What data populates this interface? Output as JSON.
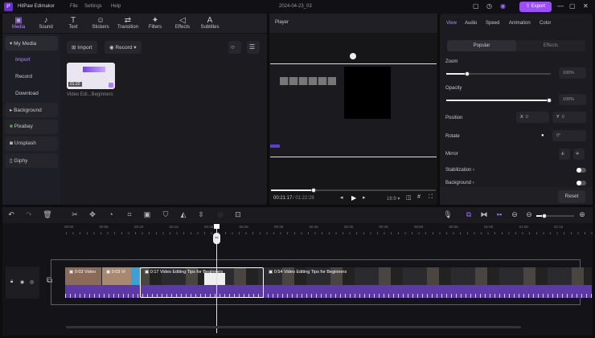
{
  "app": {
    "name": "HitPaw Edimakor",
    "project": "2024-04-23_03",
    "menu": [
      "File",
      "Settings",
      "Help"
    ],
    "export_label": "Export",
    "accent": "#9b4dff"
  },
  "toolbar_tabs": [
    {
      "label": "Media",
      "icon": "media-icon",
      "g": "▣"
    },
    {
      "label": "Sound",
      "icon": "music-icon",
      "g": "♪"
    },
    {
      "label": "Text",
      "icon": "text-icon",
      "g": "T"
    },
    {
      "label": "Stickers",
      "icon": "sticker-icon",
      "g": "☺"
    },
    {
      "label": "Transition",
      "icon": "transition-icon",
      "g": "⇄"
    },
    {
      "label": "Filters",
      "icon": "filter-icon",
      "g": "✦"
    },
    {
      "label": "Effects",
      "icon": "effects-icon",
      "g": "◁"
    },
    {
      "label": "Subtitles",
      "icon": "subtitles-icon",
      "g": "A"
    }
  ],
  "sidebar": {
    "group": "My Media",
    "sub": [
      "Import",
      "Record",
      "Download"
    ],
    "items": [
      "Background",
      "Pixabay",
      "Unsplash",
      "Giphy"
    ]
  },
  "media": {
    "import_label": "Import",
    "record_label": "Record",
    "thumb_duration": "01:22",
    "thumb_name": "Video Edi...Beginners"
  },
  "player": {
    "title": "Player",
    "current": "00:21:17",
    "total": "01:22:28",
    "ratio": "16:9",
    "progress": 0.26
  },
  "props": {
    "tabs": [
      "View",
      "Audio",
      "Speed",
      "Animation",
      "Color"
    ],
    "subtabs": [
      "Popular",
      "Effects"
    ],
    "zoom_label": "Zoom",
    "zoom_value": "100%",
    "opacity_label": "Opacity",
    "opacity_value": "100%",
    "position_label": "Position",
    "x_label": "X",
    "x_value": "0",
    "y_label": "Y",
    "y_value": "0",
    "rotate_label": "Rotate",
    "rotate_value": "0°",
    "mirror_label": "Mirror",
    "stabilization_label": "Stabilization",
    "background_label": "Background",
    "reset_label": "Reset"
  },
  "ruler": [
    "00:00",
    "00:05",
    "00:10",
    "00:15",
    "00:20",
    "00:25",
    "00:30",
    "00:35",
    "00:40",
    "00:45",
    "00:50",
    "00:55",
    "01:00",
    "01:05",
    "01:10"
  ],
  "clips": [
    "0:03 Video",
    "0:03 Vi",
    "0:17 Video Editing Tips for Beginners",
    "0:54 Video Editing Tips for Beginners"
  ]
}
